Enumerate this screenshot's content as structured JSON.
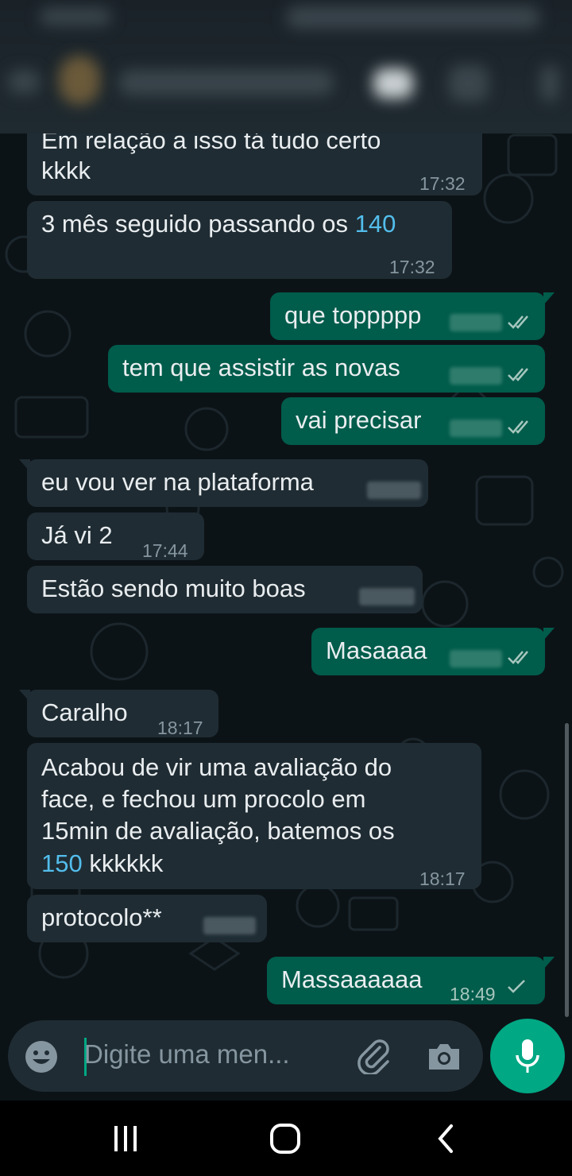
{
  "messages": [
    {
      "text_line1": "Em relação a isso tá tudo certo",
      "text_line2": "kkkk",
      "time": "17:32"
    },
    {
      "text": "3 mês seguido passando os ",
      "highlight": "140",
      "time": "17:32"
    },
    {
      "text": "que toppppp"
    },
    {
      "text": "tem que assistir as novas"
    },
    {
      "text": "vai precisar"
    },
    {
      "text": "eu vou ver na plataforma"
    },
    {
      "text": "Já vi 2",
      "time": "17:44"
    },
    {
      "text": "Estão sendo muito boas"
    },
    {
      "text": "Masaaaa"
    },
    {
      "text": "Caralho",
      "time": "18:17"
    },
    {
      "line1": "Acabou de vir uma avaliação do",
      "line2": "face, e fechou um procolo em",
      "line3": "15min de avaliação, batemos os",
      "line4_highlight": "150",
      "line4_rest": " kkkkkk",
      "time": "18:17"
    },
    {
      "text": "protocolo**"
    },
    {
      "text": "Massaaaaaa",
      "time": "18:49"
    }
  ],
  "input": {
    "placeholder": "Digite uma men..."
  },
  "icons": [
    "emoji-icon",
    "attach-icon",
    "camera-icon",
    "mic-icon",
    "read-ticks-icon",
    "sent-tick-icon",
    "recents-nav-icon",
    "home-nav-icon",
    "back-nav-icon"
  ],
  "colors": {
    "incoming": "#1f2c33",
    "outgoing": "#005c4b",
    "accent": "#00a884",
    "link": "#53bdeb"
  }
}
